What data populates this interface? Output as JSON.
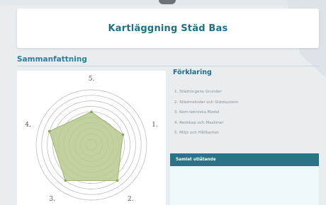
{
  "header": {
    "title": "Kartläggning Städ Bas"
  },
  "summary_section": {
    "heading": "Sammanfattning"
  },
  "legend": {
    "title": "Förklaring",
    "items": [
      "1.  Städningens Grunder",
      "2.  Städmetoder och Städsystem",
      "3.  Kem-tekniska Medel",
      "4.  Redskap och Maskiner",
      "5.  Miljö och Hållbarhet"
    ]
  },
  "overall_statement": {
    "label": "Samlat utlåtande"
  },
  "chart_data": {
    "type": "radar",
    "axes": [
      "1.",
      "2.",
      "3.",
      "4.",
      "5."
    ],
    "values": [
      3,
      4,
      4,
      4,
      3
    ],
    "rmax": 5,
    "rings": 10,
    "colors": {
      "fill": "#b9c98f",
      "stroke": "#9fb56a",
      "point": "#8aa65a",
      "ring": "#b5b5b5"
    }
  }
}
